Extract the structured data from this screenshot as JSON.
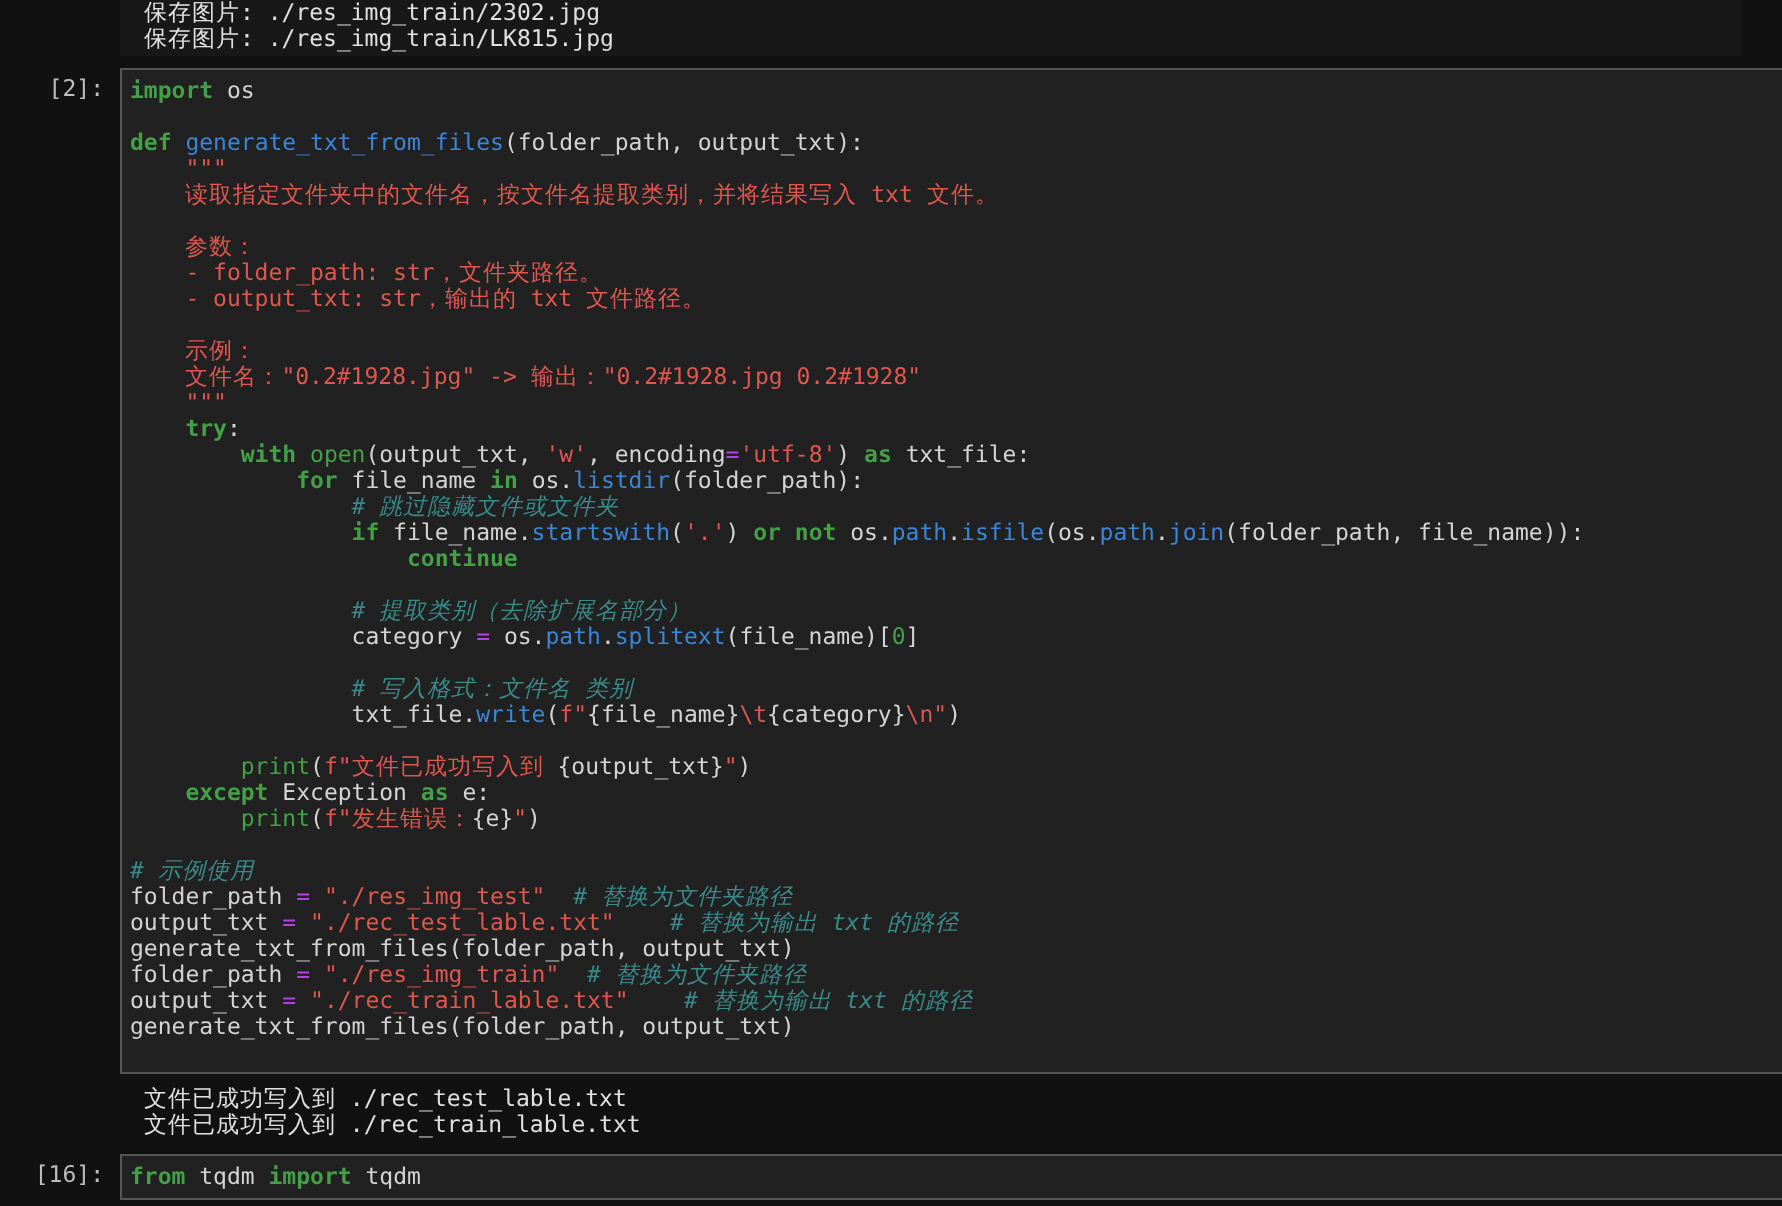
{
  "top_output": {
    "lines": [
      "保存图片: ./res_img_train/2302.jpg",
      "保存图片: ./res_img_train/LK815.jpg"
    ]
  },
  "cell": {
    "prompt": "[2]:",
    "lines": [
      {
        "kind": "code",
        "tokens": [
          {
            "kind": "keyword",
            "text": "import"
          },
          {
            "kind": "plain",
            "text": " os"
          }
        ]
      },
      {
        "kind": "blank"
      },
      {
        "kind": "code",
        "tokens": [
          {
            "kind": "keyword",
            "text": "def "
          },
          {
            "kind": "name",
            "text": "generate_txt_from_files"
          },
          {
            "kind": "plain",
            "text": "(folder_path, output_txt):"
          }
        ]
      },
      {
        "kind": "code",
        "tokens": [
          {
            "kind": "string",
            "text": "    \"\"\""
          }
        ]
      },
      {
        "kind": "code",
        "tokens": [
          {
            "kind": "string",
            "text": "    读取指定文件夹中的文件名，按文件名提取类别，并将结果写入 txt 文件。"
          }
        ]
      },
      {
        "kind": "blank"
      },
      {
        "kind": "code",
        "tokens": [
          {
            "kind": "string",
            "text": "    参数："
          }
        ]
      },
      {
        "kind": "code",
        "tokens": [
          {
            "kind": "string",
            "text": "    - folder_path: str，文件夹路径。"
          }
        ]
      },
      {
        "kind": "code",
        "tokens": [
          {
            "kind": "string",
            "text": "    - output_txt: str，输出的 txt 文件路径。"
          }
        ]
      },
      {
        "kind": "blank"
      },
      {
        "kind": "code",
        "tokens": [
          {
            "kind": "string",
            "text": "    示例："
          }
        ]
      },
      {
        "kind": "code",
        "tokens": [
          {
            "kind": "string",
            "text": "    文件名：\"0.2#1928.jpg\" -> 输出：\"0.2#1928.jpg 0.2#1928\""
          }
        ]
      },
      {
        "kind": "code",
        "tokens": [
          {
            "kind": "string",
            "text": "    \"\"\""
          }
        ]
      },
      {
        "kind": "code",
        "tokens": [
          {
            "kind": "keyword",
            "text": "    try"
          },
          {
            "kind": "plain",
            "text": ":"
          }
        ]
      },
      {
        "kind": "code",
        "tokens": [
          {
            "kind": "keyword",
            "text": "        with"
          },
          {
            "kind": "builtin",
            "text": " open"
          },
          {
            "kind": "plain",
            "text": "(output_txt, "
          },
          {
            "kind": "string",
            "text": "'w'"
          },
          {
            "kind": "plain",
            "text": ", encoding"
          },
          {
            "kind": "operator",
            "text": "="
          },
          {
            "kind": "string",
            "text": "'utf-8'"
          },
          {
            "kind": "plain",
            "text": ") "
          },
          {
            "kind": "keyword",
            "text": "as"
          },
          {
            "kind": "plain",
            "text": " txt_file:"
          }
        ]
      },
      {
        "kind": "code",
        "tokens": [
          {
            "kind": "keyword",
            "text": "            for"
          },
          {
            "kind": "plain",
            "text": " file_name "
          },
          {
            "kind": "keyword",
            "text": "in"
          },
          {
            "kind": "plain",
            "text": " os."
          },
          {
            "kind": "name",
            "text": "listdir"
          },
          {
            "kind": "plain",
            "text": "(folder_path):"
          }
        ]
      },
      {
        "kind": "code",
        "tokens": [
          {
            "kind": "comment",
            "text": "                # 跳过隐藏文件或文件夹"
          }
        ]
      },
      {
        "kind": "code",
        "tokens": [
          {
            "kind": "keyword",
            "text": "                if"
          },
          {
            "kind": "plain",
            "text": " file_name."
          },
          {
            "kind": "name",
            "text": "startswith"
          },
          {
            "kind": "plain",
            "text": "("
          },
          {
            "kind": "string",
            "text": "'.'"
          },
          {
            "kind": "plain",
            "text": ") "
          },
          {
            "kind": "keyword",
            "text": "or not"
          },
          {
            "kind": "plain",
            "text": " os."
          },
          {
            "kind": "name",
            "text": "path"
          },
          {
            "kind": "plain",
            "text": "."
          },
          {
            "kind": "name",
            "text": "isfile"
          },
          {
            "kind": "plain",
            "text": "(os."
          },
          {
            "kind": "name",
            "text": "path"
          },
          {
            "kind": "plain",
            "text": "."
          },
          {
            "kind": "name",
            "text": "join"
          },
          {
            "kind": "plain",
            "text": "(folder_path, file_name)):"
          }
        ]
      },
      {
        "kind": "code",
        "tokens": [
          {
            "kind": "keyword",
            "text": "                    continue"
          }
        ]
      },
      {
        "kind": "blank"
      },
      {
        "kind": "code",
        "tokens": [
          {
            "kind": "comment",
            "text": "                # 提取类别（去除扩展名部分）"
          }
        ]
      },
      {
        "kind": "code",
        "tokens": [
          {
            "kind": "plain",
            "text": "                category "
          },
          {
            "kind": "operator",
            "text": "="
          },
          {
            "kind": "plain",
            "text": " os."
          },
          {
            "kind": "name",
            "text": "path"
          },
          {
            "kind": "plain",
            "text": "."
          },
          {
            "kind": "name",
            "text": "splitext"
          },
          {
            "kind": "plain",
            "text": "(file_name)["
          },
          {
            "kind": "number",
            "text": "0"
          },
          {
            "kind": "plain",
            "text": "]"
          }
        ]
      },
      {
        "kind": "blank"
      },
      {
        "kind": "code",
        "tokens": [
          {
            "kind": "comment",
            "text": "                # 写入格式：文件名 类别"
          }
        ]
      },
      {
        "kind": "code",
        "tokens": [
          {
            "kind": "plain",
            "text": "                txt_file."
          },
          {
            "kind": "name",
            "text": "write"
          },
          {
            "kind": "plain",
            "text": "("
          },
          {
            "kind": "string",
            "text": "f\""
          },
          {
            "kind": "plain",
            "text": "{file_name}"
          },
          {
            "kind": "escape",
            "text": "\\t"
          },
          {
            "kind": "plain",
            "text": "{category}"
          },
          {
            "kind": "escape",
            "text": "\\n"
          },
          {
            "kind": "string",
            "text": "\""
          },
          {
            "kind": "plain",
            "text": ")"
          }
        ]
      },
      {
        "kind": "blank"
      },
      {
        "kind": "code",
        "tokens": [
          {
            "kind": "builtin",
            "text": "        print"
          },
          {
            "kind": "plain",
            "text": "("
          },
          {
            "kind": "string",
            "text": "f\"文件已成功写入到 "
          },
          {
            "kind": "plain",
            "text": "{output_txt}"
          },
          {
            "kind": "string",
            "text": "\""
          },
          {
            "kind": "plain",
            "text": ")"
          }
        ]
      },
      {
        "kind": "code",
        "tokens": [
          {
            "kind": "keyword",
            "text": "    except"
          },
          {
            "kind": "plain",
            "text": " Exception "
          },
          {
            "kind": "keyword",
            "text": "as"
          },
          {
            "kind": "plain",
            "text": " e:"
          }
        ]
      },
      {
        "kind": "code",
        "tokens": [
          {
            "kind": "builtin",
            "text": "        print"
          },
          {
            "kind": "plain",
            "text": "("
          },
          {
            "kind": "string",
            "text": "f\"发生错误："
          },
          {
            "kind": "plain",
            "text": "{e}"
          },
          {
            "kind": "string",
            "text": "\""
          },
          {
            "kind": "plain",
            "text": ")"
          }
        ]
      },
      {
        "kind": "blank"
      },
      {
        "kind": "code",
        "tokens": [
          {
            "kind": "comment",
            "text": "# 示例使用"
          }
        ]
      },
      {
        "kind": "code",
        "tokens": [
          {
            "kind": "plain",
            "text": "folder_path "
          },
          {
            "kind": "operator",
            "text": "="
          },
          {
            "kind": "string",
            "text": " \"./res_img_test\""
          },
          {
            "kind": "comment",
            "text": "  # 替换为文件夹路径"
          }
        ]
      },
      {
        "kind": "code",
        "tokens": [
          {
            "kind": "plain",
            "text": "output_txt "
          },
          {
            "kind": "operator",
            "text": "="
          },
          {
            "kind": "string",
            "text": " \"./rec_test_lable.txt\""
          },
          {
            "kind": "comment",
            "text": "    # 替换为输出 txt 的路径"
          }
        ]
      },
      {
        "kind": "code",
        "tokens": [
          {
            "kind": "plain",
            "text": "generate_txt_from_files(folder_path, output_txt)"
          }
        ]
      },
      {
        "kind": "code",
        "tokens": [
          {
            "kind": "plain",
            "text": "folder_path "
          },
          {
            "kind": "operator",
            "text": "="
          },
          {
            "kind": "string",
            "text": " \"./res_img_train\""
          },
          {
            "kind": "comment",
            "text": "  # 替换为文件夹路径"
          }
        ]
      },
      {
        "kind": "code",
        "tokens": [
          {
            "kind": "plain",
            "text": "output_txt "
          },
          {
            "kind": "operator",
            "text": "="
          },
          {
            "kind": "string",
            "text": " \"./rec_train_lable.txt\""
          },
          {
            "kind": "comment",
            "text": "    # 替换为输出 txt 的路径"
          }
        ]
      },
      {
        "kind": "code",
        "tokens": [
          {
            "kind": "plain",
            "text": "generate_txt_from_files(folder_path, output_txt)"
          }
        ]
      }
    ]
  },
  "output": {
    "lines": [
      "文件已成功写入到 ./rec_test_lable.txt",
      "文件已成功写入到 ./rec_train_lable.txt"
    ]
  },
  "next_cell": {
    "prompt": "[16]:",
    "lines": [
      {
        "kind": "code",
        "tokens": [
          {
            "kind": "keyword",
            "text": "from"
          },
          {
            "kind": "plain",
            "text": " tqdm "
          },
          {
            "kind": "keyword",
            "text": "import"
          },
          {
            "kind": "plain",
            "text": " tqdm"
          }
        ]
      }
    ]
  }
}
